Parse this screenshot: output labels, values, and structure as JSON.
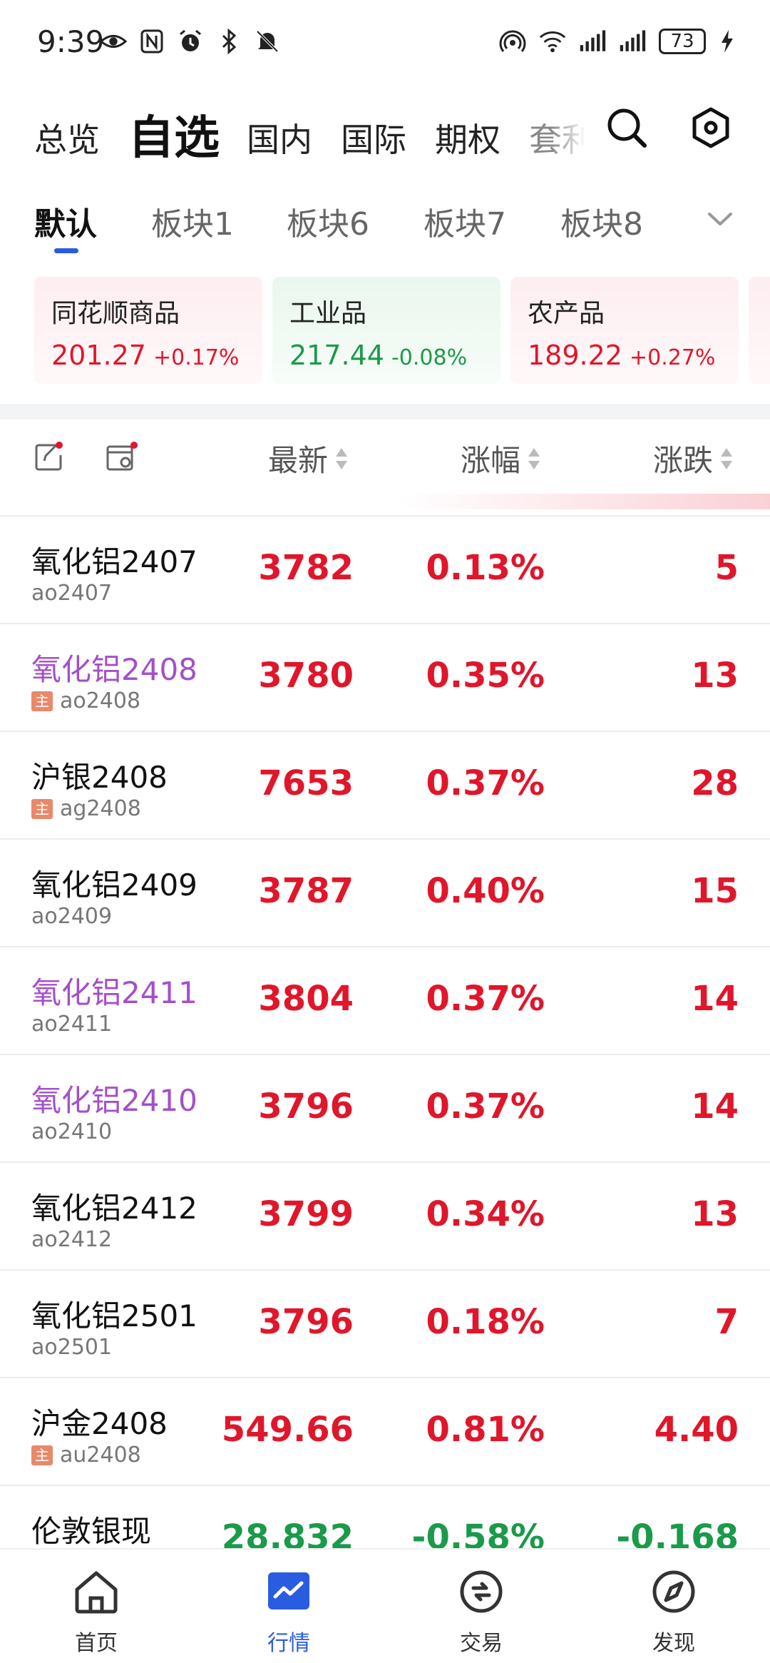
{
  "status_bar": {
    "time": "9:39",
    "battery": "73",
    "left_icons": [
      "eye-icon",
      "nfc-icon",
      "alarm-icon",
      "bluetooth-icon",
      "mute-icon"
    ],
    "right_icons": [
      "hotspot-icon",
      "wifi-icon",
      "signal-icon",
      "signal-icon",
      "battery-icon",
      "charging-icon"
    ]
  },
  "top_tabs": [
    {
      "label": "总览",
      "active": false
    },
    {
      "label": "自选",
      "active": true
    },
    {
      "label": "国内",
      "active": false
    },
    {
      "label": "国际",
      "active": false
    },
    {
      "label": "期权",
      "active": false
    },
    {
      "label": "套利",
      "active": false
    }
  ],
  "sub_tabs": [
    {
      "label": "默认",
      "active": true
    },
    {
      "label": "板块1",
      "active": false
    },
    {
      "label": "板块6",
      "active": false
    },
    {
      "label": "板块7",
      "active": false
    },
    {
      "label": "板块8",
      "active": false
    }
  ],
  "index_cards": [
    {
      "name": "同花顺商品",
      "price": "201.27",
      "change": "+0.17%",
      "trend": "up"
    },
    {
      "name": "工业品",
      "price": "217.44",
      "change": "-0.08%",
      "trend": "down"
    },
    {
      "name": "农产品",
      "price": "189.22",
      "change": "+0.27%",
      "trend": "up"
    }
  ],
  "list_header": {
    "col_latest": "最新",
    "col_change_pct": "涨幅",
    "col_change": "涨跌"
  },
  "badge_main": "主",
  "rows": [
    {
      "name": "氧化铝2407",
      "code": "ao2407",
      "main": false,
      "purple": false,
      "price": "3782",
      "pct": "0.13%",
      "chg": "5",
      "trend": "up"
    },
    {
      "name": "氧化铝2408",
      "code": "ao2408",
      "main": true,
      "purple": true,
      "price": "3780",
      "pct": "0.35%",
      "chg": "13",
      "trend": "up"
    },
    {
      "name": "沪银2408",
      "code": "ag2408",
      "main": true,
      "purple": false,
      "price": "7653",
      "pct": "0.37%",
      "chg": "28",
      "trend": "up"
    },
    {
      "name": "氧化铝2409",
      "code": "ao2409",
      "main": false,
      "purple": false,
      "price": "3787",
      "pct": "0.40%",
      "chg": "15",
      "trend": "up"
    },
    {
      "name": "氧化铝2411",
      "code": "ao2411",
      "main": false,
      "purple": true,
      "price": "3804",
      "pct": "0.37%",
      "chg": "14",
      "trend": "up"
    },
    {
      "name": "氧化铝2410",
      "code": "ao2410",
      "main": false,
      "purple": true,
      "price": "3796",
      "pct": "0.37%",
      "chg": "14",
      "trend": "up"
    },
    {
      "name": "氧化铝2412",
      "code": "ao2412",
      "main": false,
      "purple": false,
      "price": "3799",
      "pct": "0.34%",
      "chg": "13",
      "trend": "up"
    },
    {
      "name": "氧化铝2501",
      "code": "ao2501",
      "main": false,
      "purple": false,
      "price": "3796",
      "pct": "0.18%",
      "chg": "7",
      "trend": "up"
    },
    {
      "name": "沪金2408",
      "code": "au2408",
      "main": true,
      "purple": false,
      "price": "549.66",
      "pct": "0.81%",
      "chg": "4.40",
      "trend": "up"
    },
    {
      "name": "伦敦银现",
      "code": "",
      "main": false,
      "purple": false,
      "price": "28.832",
      "pct": "-0.58%",
      "chg": "-0.168",
      "trend": "down"
    }
  ],
  "bottom_nav": [
    {
      "label": "首页",
      "icon": "home-icon",
      "active": false
    },
    {
      "label": "行情",
      "icon": "chart-icon",
      "active": true
    },
    {
      "label": "交易",
      "icon": "trade-icon",
      "active": false
    },
    {
      "label": "发现",
      "icon": "compass-icon",
      "active": false
    }
  ],
  "colors": {
    "up": "#e0162b",
    "down": "#1a9a4a",
    "accent": "#2a5cdf",
    "purple_name": "#a44fc9"
  }
}
